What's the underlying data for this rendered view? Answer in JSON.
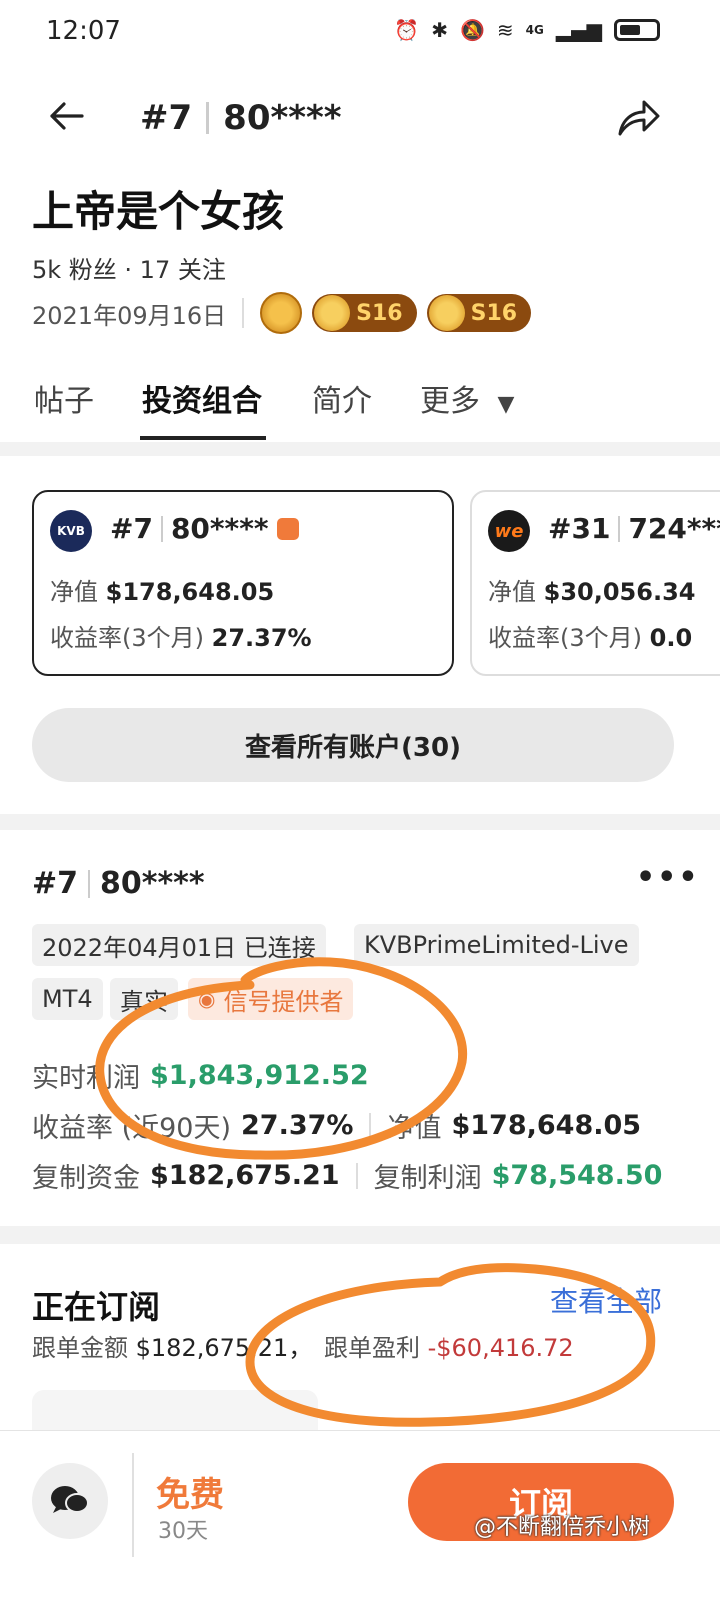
{
  "status_bar": {
    "time": "12:07",
    "network": "4G"
  },
  "header": {
    "rank": "#7",
    "account": "80****"
  },
  "profile": {
    "name": "上帝是个女孩",
    "stats": "5k 粉丝 · 17 关注",
    "date": "2021年09月16日",
    "badges": [
      "S16",
      "S16"
    ]
  },
  "tabs": [
    "帖子",
    "投资组合",
    "简介",
    "更多"
  ],
  "accounts": [
    {
      "logo": "KVB",
      "rank": "#7",
      "account": "80****",
      "equity_label": "净值",
      "equity": "$178,648.05",
      "return_label": "收益率(3个月)",
      "return": "27.37%"
    },
    {
      "logo": "we",
      "rank": "#31",
      "account": "724***",
      "equity_label": "净值",
      "equity": "$30,056.34",
      "return_label": "收益率(3个月)",
      "return": "0.0"
    }
  ],
  "view_all_accounts": "查看所有账户(30)",
  "detail": {
    "rank": "#7",
    "account": "80****",
    "tags": [
      "2022年04月01日 已连接",
      "KVBPrimeLimited-Live",
      "MT4",
      "真实",
      "信号提供者"
    ],
    "realtime_profit_label": "实时利润",
    "realtime_profit": "$1,843,912.52",
    "return_label": "收益率 (近90天)",
    "return": "27.37%",
    "equity_label": "净值",
    "equity": "$178,648.05",
    "copy_funds_label": "复制资金",
    "copy_funds": "$182,675.21",
    "copy_profit_label": "复制利润",
    "copy_profit": "$78,548.50"
  },
  "subscribing": {
    "title": "正在订阅",
    "view_all": "查看全部",
    "amount_label": "跟单金额",
    "amount": "$182,675.21，",
    "profit_label": "跟单盈利",
    "profit": "-$60,416.72"
  },
  "bottom": {
    "free": "免费",
    "days": "30天",
    "subscribe": "订阅",
    "watermark": "@不断翻倍乔小树"
  },
  "colors": {
    "accent": "#f26b35",
    "profit_green": "#2a9d6a",
    "loss_red": "#c23a3a",
    "link_blue": "#3a6fd8"
  }
}
